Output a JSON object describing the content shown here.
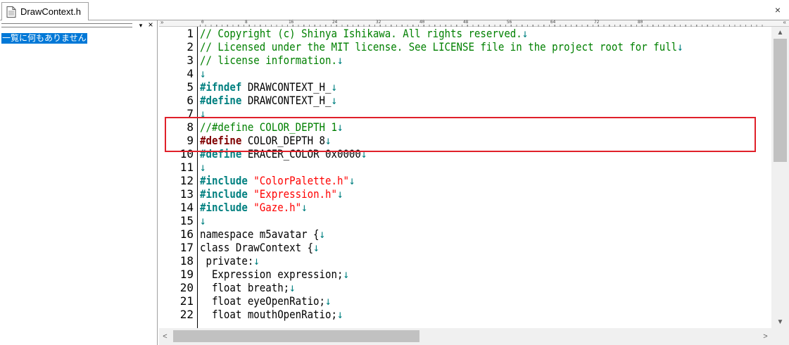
{
  "tab": {
    "title": "DrawContext.h",
    "close_glyph": "×"
  },
  "outline": {
    "menu_glyph": "▾",
    "close_glyph": "×",
    "empty_message": "一覧に何もありません"
  },
  "ruler": {
    "left_glyph": "»",
    "right_glyph": "«",
    "labels": [
      "0",
      "8",
      "16",
      "24",
      "32",
      "40",
      "48",
      "56",
      "64",
      "72",
      "80"
    ]
  },
  "colors": {
    "comment": "#008000",
    "preprocessor": "#008080",
    "string": "#ff0000",
    "highlight_box": "#e0202a",
    "selection": "#0078d7"
  },
  "newline_glyph": "↓",
  "code_lines": [
    {
      "num": "1",
      "segments": [
        {
          "cls": "c-comment",
          "text": "// Copyright (c) Shinya Ishikawa. All rights reserved."
        }
      ]
    },
    {
      "num": "2",
      "segments": [
        {
          "cls": "c-comment",
          "text": "// Licensed under the MIT license. See LICENSE file in the project root for full"
        }
      ]
    },
    {
      "num": "3",
      "segments": [
        {
          "cls": "c-comment",
          "text": "// license information."
        }
      ]
    },
    {
      "num": "4",
      "segments": []
    },
    {
      "num": "5",
      "segments": [
        {
          "cls": "c-pp",
          "text": "#ifndef"
        },
        {
          "cls": "c-normal",
          "text": " DRAWCONTEXT_H_"
        }
      ]
    },
    {
      "num": "6",
      "segments": [
        {
          "cls": "c-pp",
          "text": "#define"
        },
        {
          "cls": "c-normal",
          "text": " DRAWCONTEXT_H_"
        }
      ]
    },
    {
      "num": "7",
      "segments": []
    },
    {
      "num": "8",
      "segments": [
        {
          "cls": "c-comment",
          "text": "//#define COLOR_DEPTH 1"
        }
      ]
    },
    {
      "num": "9",
      "segments": [
        {
          "cls": "c-pp-em",
          "text": "#define"
        },
        {
          "cls": "c-normal",
          "text": " COLOR_DEPTH 8"
        }
      ]
    },
    {
      "num": "10",
      "segments": [
        {
          "cls": "c-pp",
          "text": "#define"
        },
        {
          "cls": "c-normal",
          "text": " ERACER_COLOR 0x0000"
        }
      ]
    },
    {
      "num": "11",
      "segments": []
    },
    {
      "num": "12",
      "segments": [
        {
          "cls": "c-pp",
          "text": "#include"
        },
        {
          "cls": "c-normal",
          "text": " "
        },
        {
          "cls": "c-str",
          "text": "\"ColorPalette.h\""
        }
      ]
    },
    {
      "num": "13",
      "segments": [
        {
          "cls": "c-pp",
          "text": "#include"
        },
        {
          "cls": "c-normal",
          "text": " "
        },
        {
          "cls": "c-str",
          "text": "\"Expression.h\""
        }
      ]
    },
    {
      "num": "14",
      "segments": [
        {
          "cls": "c-pp",
          "text": "#include"
        },
        {
          "cls": "c-normal",
          "text": " "
        },
        {
          "cls": "c-str",
          "text": "\"Gaze.h\""
        }
      ]
    },
    {
      "num": "15",
      "segments": []
    },
    {
      "num": "16",
      "segments": [
        {
          "cls": "c-normal",
          "text": "namespace m5avatar {"
        }
      ]
    },
    {
      "num": "17",
      "segments": [
        {
          "cls": "c-normal",
          "text": "class DrawContext {"
        }
      ]
    },
    {
      "num": "18",
      "segments": [
        {
          "cls": "c-normal",
          "text": " private:"
        }
      ]
    },
    {
      "num": "19",
      "segments": [
        {
          "cls": "c-normal",
          "text": "  Expression expression;"
        }
      ]
    },
    {
      "num": "20",
      "segments": [
        {
          "cls": "c-normal",
          "text": "  float breath;"
        }
      ]
    },
    {
      "num": "21",
      "segments": [
        {
          "cls": "c-normal",
          "text": "  float eyeOpenRatio;"
        }
      ]
    },
    {
      "num": "22",
      "segments": [
        {
          "cls": "c-normal",
          "text": "  float mouthOpenRatio;"
        }
      ]
    }
  ],
  "scrollbars": {
    "up_glyph": "▲",
    "down_glyph": "▼",
    "left_glyph": "<",
    "right_glyph": ">"
  }
}
